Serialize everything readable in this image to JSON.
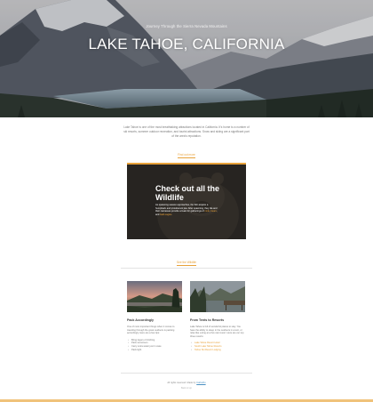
{
  "hero": {
    "subtitle": "Journey Through the Sierra Nevada Mountains",
    "title": "LAKE TAHOE, CALIFORNIA"
  },
  "intro": {
    "text": "Lake Tahoe is one of the most breathtaking attractions located in California. It's home to a number of ski resorts, summer outdoor recreation, and tourist attractions. Snow and skiing are a significant part of the area's reputation.",
    "link": "Find out more"
  },
  "feature": {
    "title": "Check out all the Wildlife",
    "text_before": "As spawning season approaches, the fish acquire a humpback and protuberant jaw. After spawning, they die and their carcasses provide a feast for gatherings of ",
    "highlight1": "mink",
    "sep1": ", ",
    "highlight2": "bears",
    "sep2": ", and ",
    "highlight3": "bald eagles",
    "text_after": ".",
    "link": "See the Wildlife"
  },
  "columns": {
    "left": {
      "heading": "Pack Accordingly",
      "text": "One of most important things when it comes to traveling through the great outdoors is packing accordingly. Here are a few tips:",
      "items": [
        "Bring layers of clothing",
        "Pack sunscreen",
        "Carry extra water just in case",
        "Pack light"
      ]
    },
    "right": {
      "heading": "From Tents to Resorts",
      "text": "Lake Tahoe is full of wonderful places to stay. You have the ability to sleep in the outdoors in a tent, or relax like a king at a five star resort. Here are our top three resorts:",
      "items": [
        "Lake Tahoe Resort Hotel",
        "South Lake Tahoe Resorts",
        "Tahoe Ski Resort Lodging"
      ]
    }
  },
  "footer": {
    "text": "All rights reserved. Made by ",
    "credit": "Cathulhu",
    "subtext": "Back to top"
  },
  "colors": {
    "accent": "#e8a23a",
    "link_blue": "#4a90c2"
  }
}
